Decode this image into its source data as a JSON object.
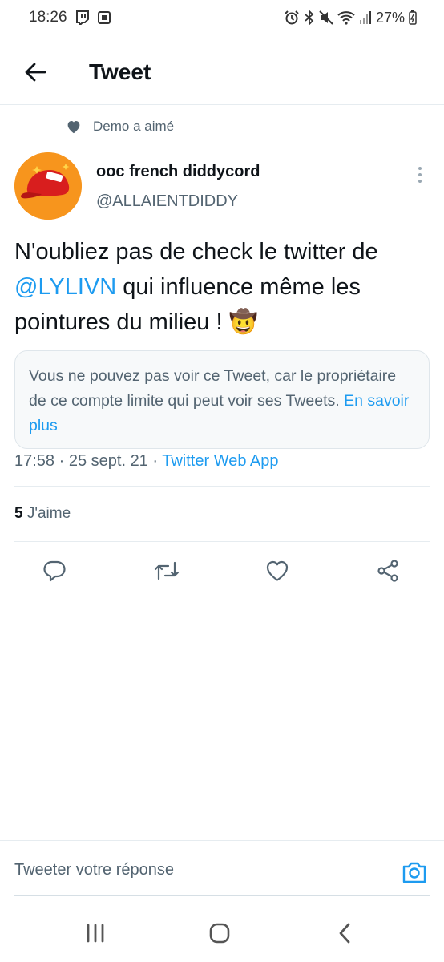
{
  "status_bar": {
    "time": "18:26",
    "battery": "27%"
  },
  "header": {
    "title": "Tweet",
    "back_icon": "arrow-left-icon"
  },
  "social_context": {
    "text": "Demo a aimé",
    "icon": "heart-filled-icon"
  },
  "author": {
    "name": "ooc french diddycord",
    "handle": "@ALLAIENTDIDDY",
    "avatar_bg": "#f7951d"
  },
  "tweet": {
    "text_before": "N'oubliez pas de check le twitter de ",
    "mention": "@LYLIVN",
    "text_after": " qui influence même les pointures du milieu ! 🤠"
  },
  "quote": {
    "text": "Vous ne pouvez pas voir ce Tweet, car le propriétaire de ce compte limite qui peut voir ses Tweets. ",
    "link": "En savoir plus"
  },
  "meta": {
    "time": "17:58",
    "date": "25 sept. 21",
    "source": "Twitter Web App"
  },
  "stats": {
    "likes_count": "5",
    "likes_label": "J'aime"
  },
  "actions": [
    "reply-icon",
    "retweet-icon",
    "like-icon",
    "share-icon"
  ],
  "reply": {
    "placeholder": "Tweeter votre réponse"
  },
  "colors": {
    "accent": "#1d9bf0",
    "text_primary": "#0f1419",
    "text_secondary": "#536471"
  }
}
